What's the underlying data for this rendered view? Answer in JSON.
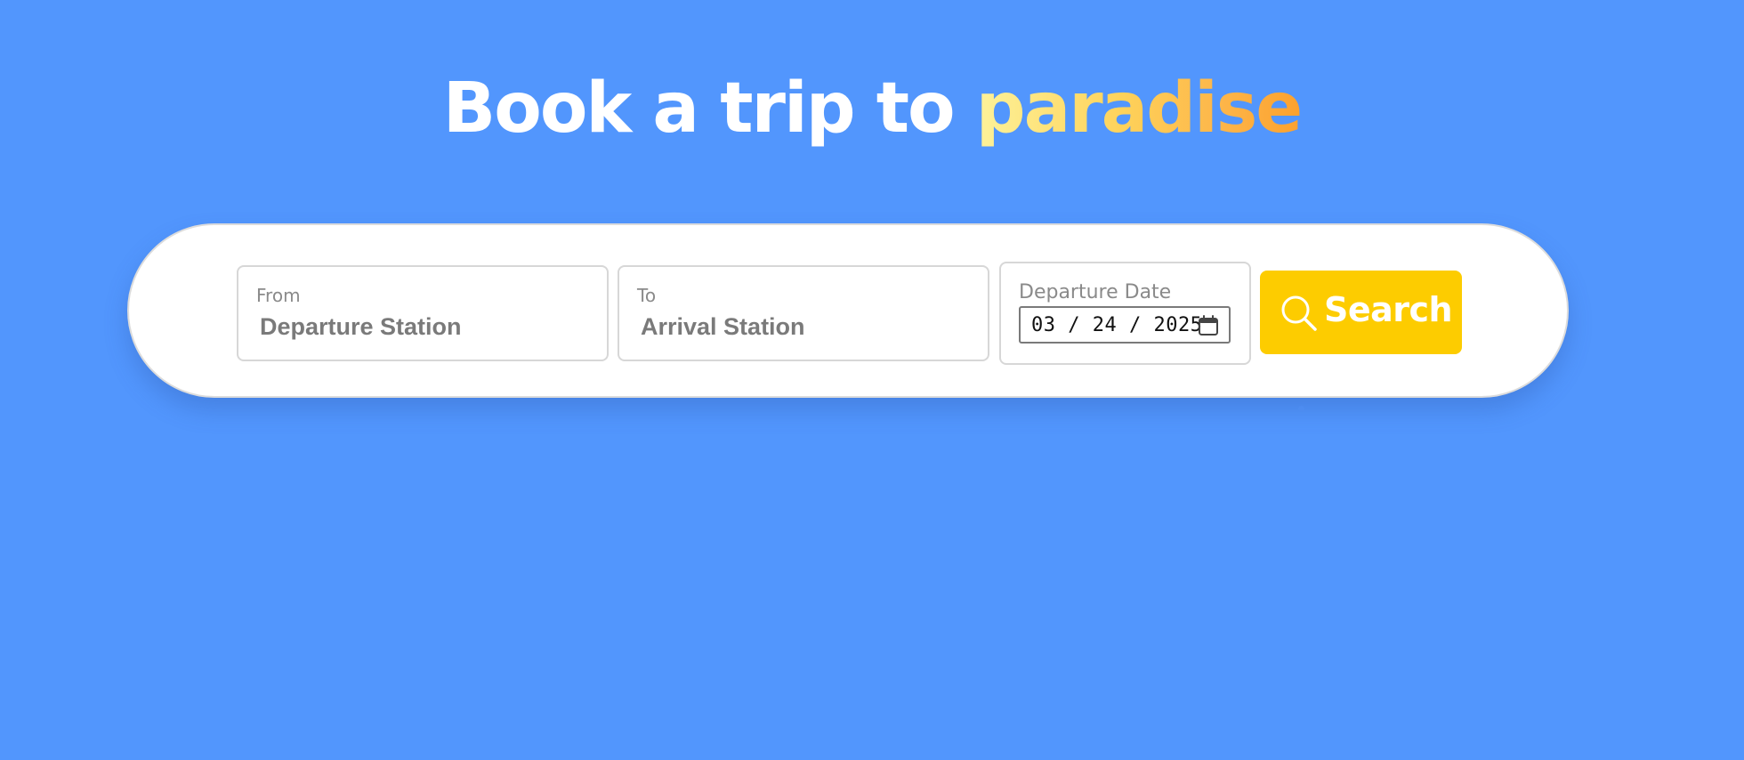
{
  "hero": {
    "title_prefix": "Book a trip to ",
    "title_accent": "paradise"
  },
  "search_form": {
    "from": {
      "label": "From",
      "value": "Departure Station"
    },
    "to": {
      "label": "To",
      "value": "Arrival Station"
    },
    "departure_date": {
      "label": "Departure Date",
      "value": "03 / 24 / 2025",
      "icon": "calendar-icon"
    },
    "search_button": {
      "label": "Search",
      "icon": "search-icon"
    }
  },
  "colors": {
    "background": "#5296fd",
    "card": "#ffffff",
    "button": "#fdcc00",
    "accent_gradient_start": "#fdf29a",
    "accent_gradient_end": "#fca12e"
  }
}
